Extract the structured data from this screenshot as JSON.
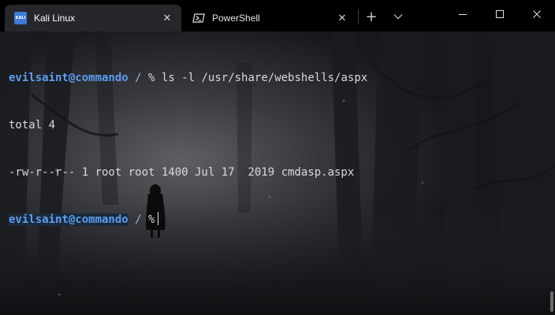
{
  "tabs": [
    {
      "title": "Kali Linux",
      "icon": "kali-icon",
      "close": "✕"
    },
    {
      "title": "PowerShell",
      "icon": "powershell-icon",
      "close": "✕"
    }
  ],
  "toolbar": {
    "new_tab": "+",
    "dropdown": "⌄"
  },
  "window_controls": {
    "minimize": "minimize-icon",
    "maximize": "maximize-icon",
    "close": "close-icon"
  },
  "terminal": {
    "user_host": "evilsaint@commando",
    "cwd": "/",
    "prompt_symbol": "%",
    "command": "ls -l /usr/share/webshells/aspx",
    "output": [
      "total 4",
      "-rw-r--r-- 1 root root 1400 Jul 17  2019 cmdasp.aspx"
    ]
  },
  "colors": {
    "prompt": "#5b9ef0",
    "text": "#d9d9d9",
    "tab_active": "#26272b",
    "titlebar": "#000000"
  }
}
